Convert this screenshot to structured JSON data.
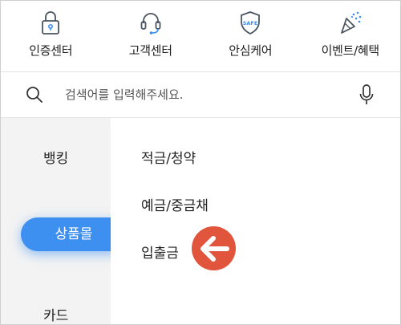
{
  "quick_menu": [
    {
      "label": "인증센터",
      "icon": "lock-icon"
    },
    {
      "label": "고객센터",
      "icon": "headset-icon"
    },
    {
      "label": "안심케어",
      "icon": "safe-shield-icon",
      "badge": "SAFE"
    },
    {
      "label": "이벤트/혜택",
      "icon": "party-popper-icon"
    }
  ],
  "search": {
    "placeholder": "검색어를 입력해주세요.",
    "icon": "search-icon",
    "mic_icon": "microphone-icon"
  },
  "sidebar": {
    "items": [
      {
        "label": "뱅킹",
        "active": false
      },
      {
        "label": "상품몰",
        "active": true
      },
      {
        "label": "카드",
        "active": false
      }
    ]
  },
  "submenu": {
    "items": [
      {
        "label": "적금/청약"
      },
      {
        "label": "예금/중금채"
      },
      {
        "label": "입출금"
      }
    ]
  },
  "annotation": {
    "icon": "left-arrow-icon",
    "color": "#e0553c"
  },
  "colors": {
    "accent": "#3d8ff0",
    "sidebar_bg": "#f3f3f3"
  }
}
